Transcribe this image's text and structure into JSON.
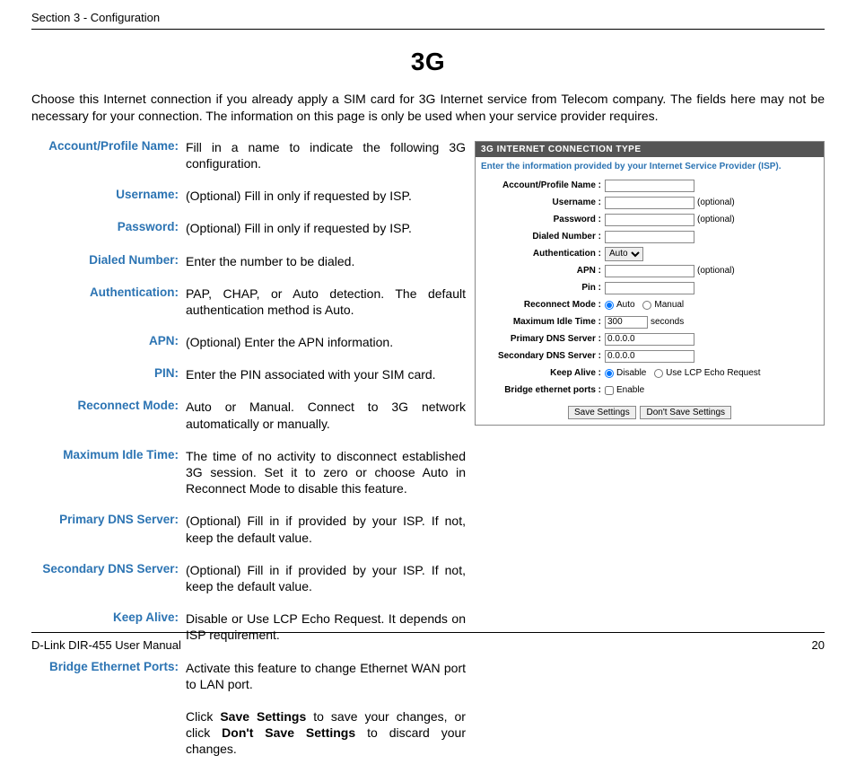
{
  "header": {
    "section": "Section 3 - Configuration"
  },
  "title": "3G",
  "intro": "Choose this Internet connection if you already apply a SIM card for 3G Internet service from Telecom company. The fields here may not be necessary for your connection. The information on this page is only be used when your service provider requires.",
  "defs": [
    {
      "label": "Account/Profile Name:",
      "desc": "Fill in a name to indicate the following 3G configuration.",
      "narrow": true
    },
    {
      "label": "Username:",
      "desc": "(Optional) Fill in only if requested by ISP."
    },
    {
      "label": "Password:",
      "desc": "(Optional) Fill in only if requested by ISP."
    },
    {
      "label": "Dialed Number:",
      "desc": "Enter the number to be dialed."
    },
    {
      "label": "Authentication:",
      "desc": "PAP, CHAP, or Auto detection. The default authentication method is Auto.",
      "narrow": true
    },
    {
      "label": "APN:",
      "desc": "(Optional) Enter the APN information."
    },
    {
      "label": "PIN:",
      "desc": "Enter the PIN associated with your SIM card."
    },
    {
      "label": "Reconnect Mode:",
      "desc": "Auto or Manual. Connect to 3G network automatically or manually."
    },
    {
      "label": "Maximum Idle Time:",
      "desc": "The time of no activity to disconnect established 3G session. Set it to zero or choose Auto in Reconnect Mode to disable this feature."
    },
    {
      "label": "Primary DNS Server:",
      "desc": "(Optional) Fill in if provided by your ISP. If not, keep the default value."
    },
    {
      "label": "Secondary DNS Server:",
      "desc": "(Optional) Fill in if provided by your ISP. If not, keep the default value."
    },
    {
      "label": "Keep Alive:",
      "desc": "Disable or Use LCP Echo Request. It depends on ISP requirement."
    },
    {
      "label": "Bridge Ethernet Ports:",
      "desc": "Activate this feature to change Ethernet WAN port to LAN port."
    }
  ],
  "bottom_note": {
    "pre": "Click ",
    "b1": "Save Settings",
    "mid": " to save your changes, or click ",
    "b2": "Don't Save Settings",
    "post": " to discard your changes."
  },
  "panel": {
    "header": "3G INTERNET CONNECTION TYPE",
    "sub": "Enter the information provided by your Internet Service Provider (ISP).",
    "labels": {
      "account": "Account/Profile Name :",
      "username": "Username :",
      "password": "Password :",
      "dialed": "Dialed Number :",
      "auth": "Authentication :",
      "apn": "APN :",
      "pin": "Pin :",
      "reconnect": "Reconnect Mode :",
      "idle": "Maximum Idle Time :",
      "pdns": "Primary DNS Server :",
      "sdns": "Secondary DNS Server :",
      "keepalive": "Keep Alive :",
      "bridge": "Bridge ethernet ports :"
    },
    "values": {
      "auth_sel": "Auto",
      "idle_val": "300",
      "idle_unit": "seconds",
      "pdns_val": "0.0.0.0",
      "sdns_val": "0.0.0.0",
      "optional": "(optional)",
      "r_auto": "Auto",
      "r_manual": "Manual",
      "ka_disable": "Disable",
      "ka_lcp": "Use LCP Echo Request",
      "bridge_en": "Enable",
      "save": "Save Settings",
      "dont": "Don't Save Settings"
    }
  },
  "footer": {
    "left": "D-Link DIR-455 User Manual",
    "right": "20"
  }
}
